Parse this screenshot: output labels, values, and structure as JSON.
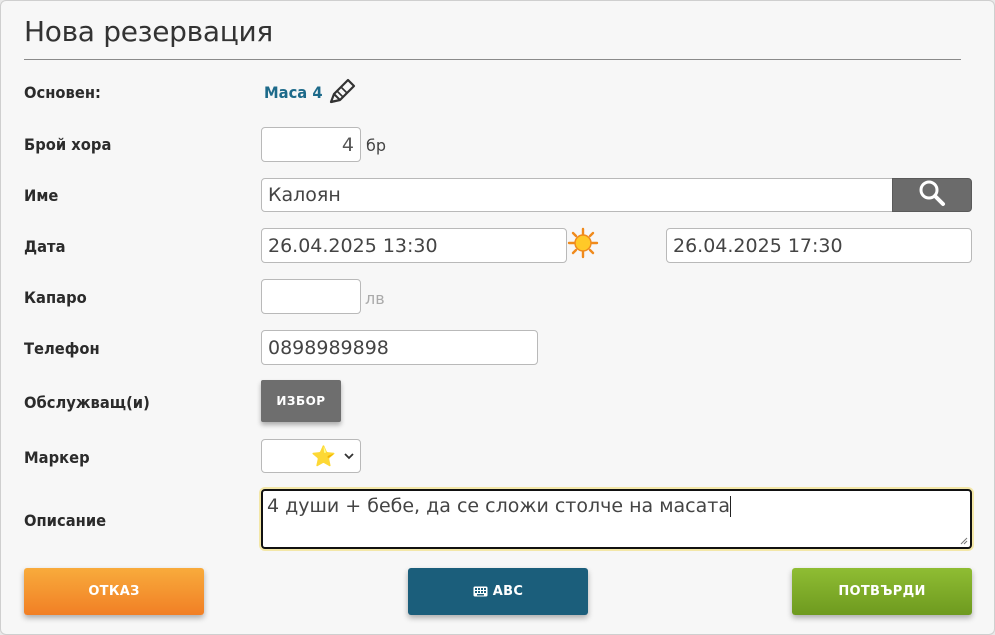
{
  "dialog": {
    "title": "Нова резервация"
  },
  "form": {
    "base": {
      "label": "Основен:",
      "value": "Маса 4"
    },
    "people": {
      "label": "Брой хора",
      "value": "4",
      "unit": "бр"
    },
    "name": {
      "label": "Име",
      "value": "Калоян"
    },
    "date": {
      "label": "Дата",
      "from": "26.04.2025 13:30",
      "to": "26.04.2025 17:30"
    },
    "deposit": {
      "label": "Капаро",
      "value": "",
      "unit": "лв"
    },
    "phone": {
      "label": "Телефон",
      "value": "0898989898"
    },
    "staff": {
      "label": "Обслужващ(и)",
      "button": "ИЗБОР"
    },
    "marker": {
      "label": "Маркер",
      "selected": "⭐"
    },
    "description": {
      "label": "Описание",
      "value": "4 души + бебе, да се сложи столче на масата"
    }
  },
  "actions": {
    "cancel": "ОТКАЗ",
    "keyboard": "ABC",
    "confirm": "ПОТВЪРДИ"
  },
  "colors": {
    "link": "#1d6a8a",
    "cancel": "#f4942f",
    "keyboard": "#1b5e7b",
    "confirm": "#7fac28"
  },
  "icons": [
    "edit-pencil-icon",
    "search-icon",
    "sun-icon",
    "chevron-down-icon",
    "keyboard-icon",
    "star-icon"
  ]
}
